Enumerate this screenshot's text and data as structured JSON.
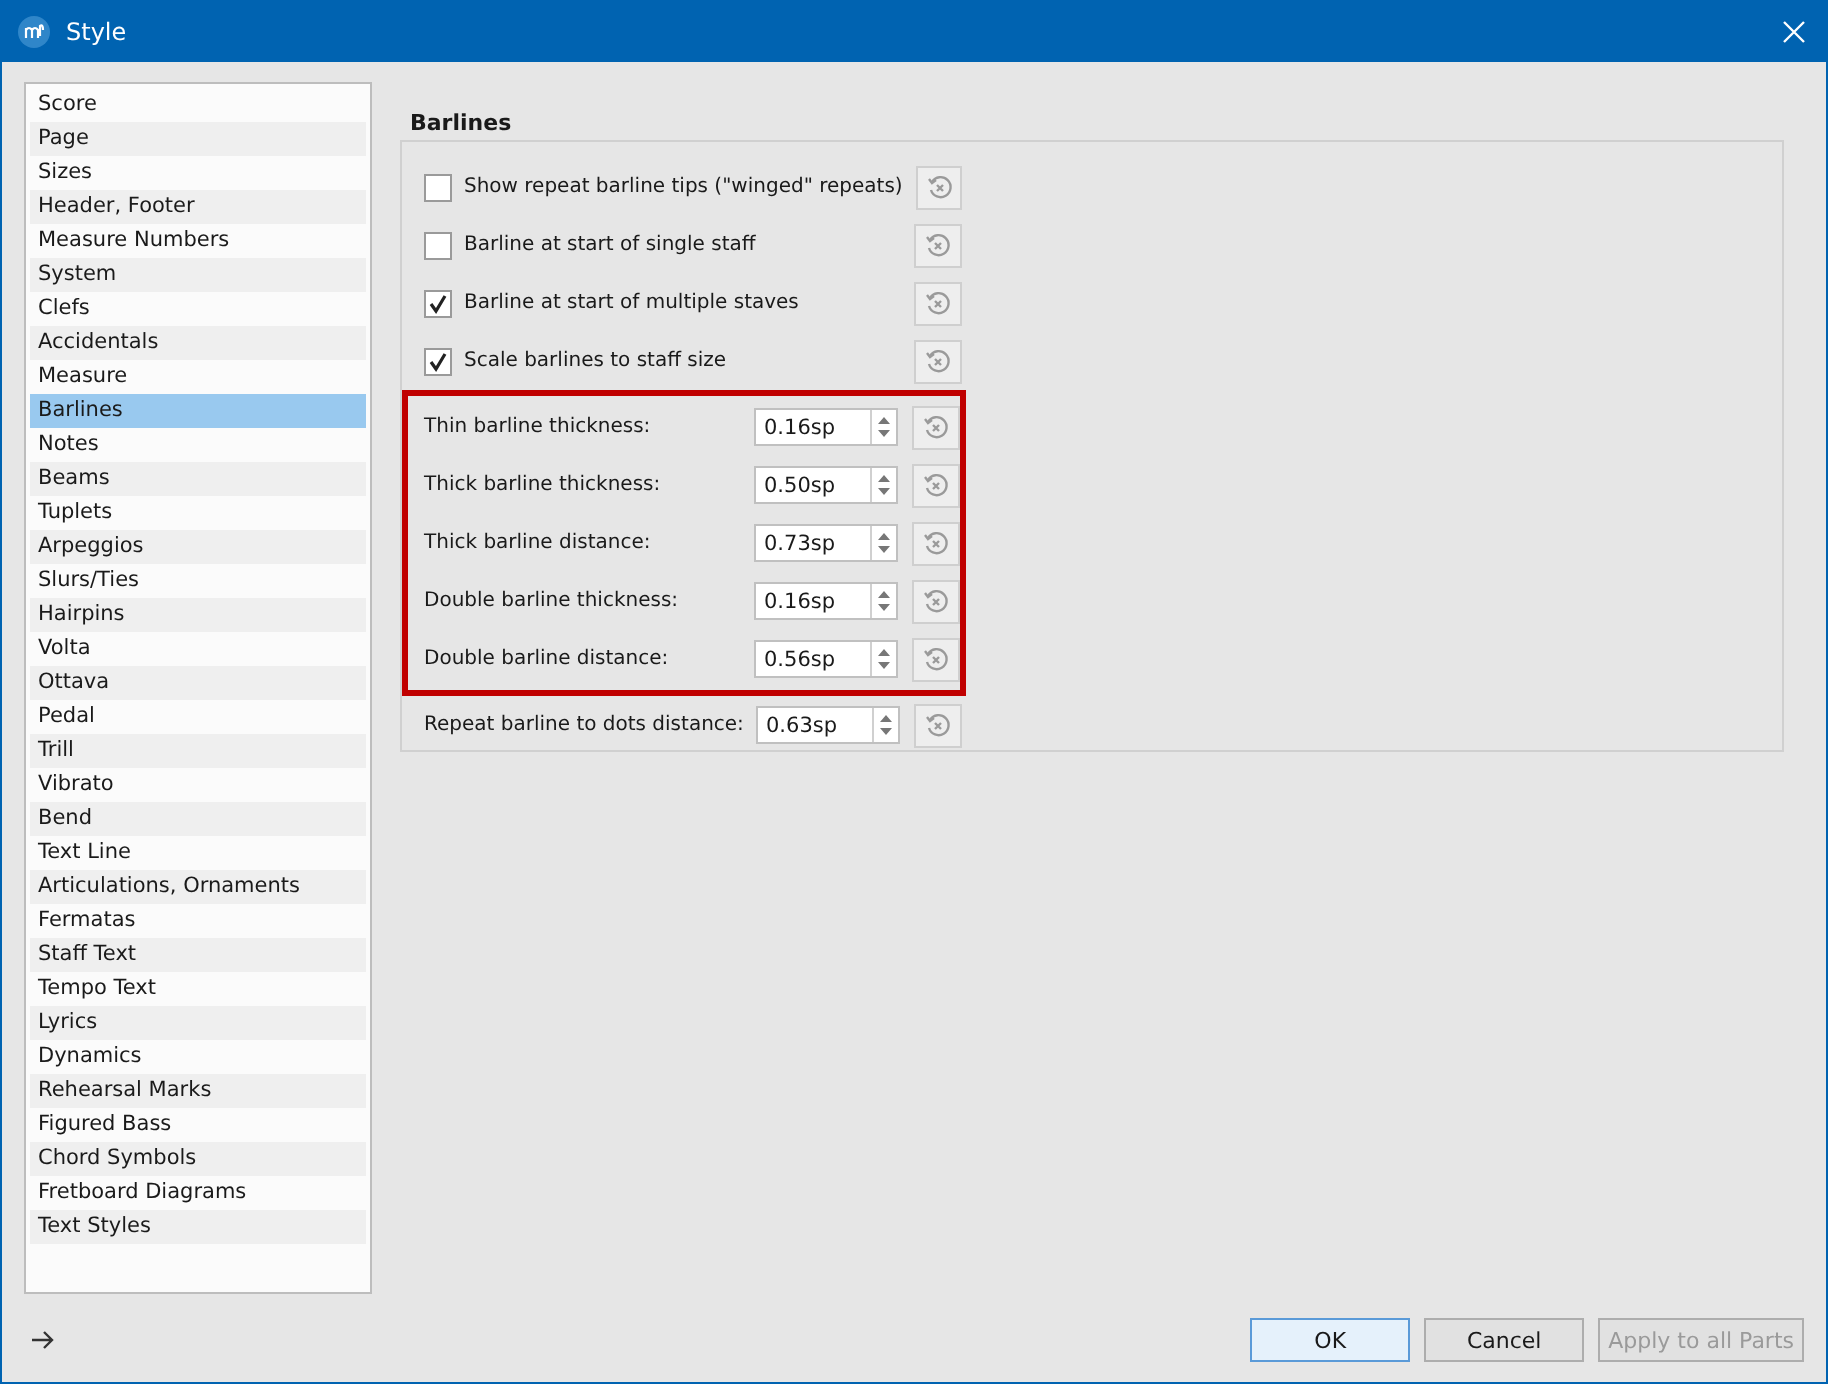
{
  "window": {
    "title": "Style"
  },
  "sidebar": {
    "items": [
      {
        "label": "Score",
        "selected": false
      },
      {
        "label": "Page",
        "selected": false
      },
      {
        "label": "Sizes",
        "selected": false
      },
      {
        "label": "Header, Footer",
        "selected": false
      },
      {
        "label": "Measure Numbers",
        "selected": false
      },
      {
        "label": "System",
        "selected": false
      },
      {
        "label": "Clefs",
        "selected": false
      },
      {
        "label": "Accidentals",
        "selected": false
      },
      {
        "label": "Measure",
        "selected": false
      },
      {
        "label": "Barlines",
        "selected": true
      },
      {
        "label": "Notes",
        "selected": false
      },
      {
        "label": "Beams",
        "selected": false
      },
      {
        "label": "Tuplets",
        "selected": false
      },
      {
        "label": "Arpeggios",
        "selected": false
      },
      {
        "label": "Slurs/Ties",
        "selected": false
      },
      {
        "label": "Hairpins",
        "selected": false
      },
      {
        "label": "Volta",
        "selected": false
      },
      {
        "label": "Ottava",
        "selected": false
      },
      {
        "label": "Pedal",
        "selected": false
      },
      {
        "label": "Trill",
        "selected": false
      },
      {
        "label": "Vibrato",
        "selected": false
      },
      {
        "label": "Bend",
        "selected": false
      },
      {
        "label": "Text Line",
        "selected": false
      },
      {
        "label": "Articulations, Ornaments",
        "selected": false
      },
      {
        "label": "Fermatas",
        "selected": false
      },
      {
        "label": "Staff Text",
        "selected": false
      },
      {
        "label": "Tempo Text",
        "selected": false
      },
      {
        "label": "Lyrics",
        "selected": false
      },
      {
        "label": "Dynamics",
        "selected": false
      },
      {
        "label": "Rehearsal Marks",
        "selected": false
      },
      {
        "label": "Figured Bass",
        "selected": false
      },
      {
        "label": "Chord Symbols",
        "selected": false
      },
      {
        "label": "Fretboard Diagrams",
        "selected": false
      },
      {
        "label": "Text Styles",
        "selected": false
      }
    ]
  },
  "panel": {
    "title": "Barlines",
    "settings": [
      {
        "kind": "checkbox",
        "label": "Show repeat barline tips (\"winged\" repeats)",
        "checked": false
      },
      {
        "kind": "checkbox",
        "label": "Barline at start of single staff",
        "checked": false
      },
      {
        "kind": "checkbox",
        "label": "Barline at start of multiple staves",
        "checked": true
      },
      {
        "kind": "checkbox",
        "label": "Scale barlines to staff size",
        "checked": true
      },
      {
        "kind": "highlight",
        "children": [
          {
            "kind": "spin",
            "label": "Thin barline thickness:",
            "value": "0.16sp"
          },
          {
            "kind": "spin",
            "label": "Thick barline thickness:",
            "value": "0.50sp"
          },
          {
            "kind": "spin",
            "label": "Thick barline distance:",
            "value": "0.73sp"
          },
          {
            "kind": "spin",
            "label": "Double barline thickness:",
            "value": "0.16sp"
          },
          {
            "kind": "spin",
            "label": "Double barline distance:",
            "value": "0.56sp"
          }
        ]
      },
      {
        "kind": "spin",
        "label": "Repeat barline to dots distance:",
        "value": "0.63sp"
      }
    ]
  },
  "buttons": [
    {
      "label": "OK",
      "disabled": false,
      "default": true
    },
    {
      "label": "Cancel",
      "disabled": false,
      "default": false
    },
    {
      "label": "Apply to all Parts",
      "disabled": true,
      "default": false
    }
  ]
}
